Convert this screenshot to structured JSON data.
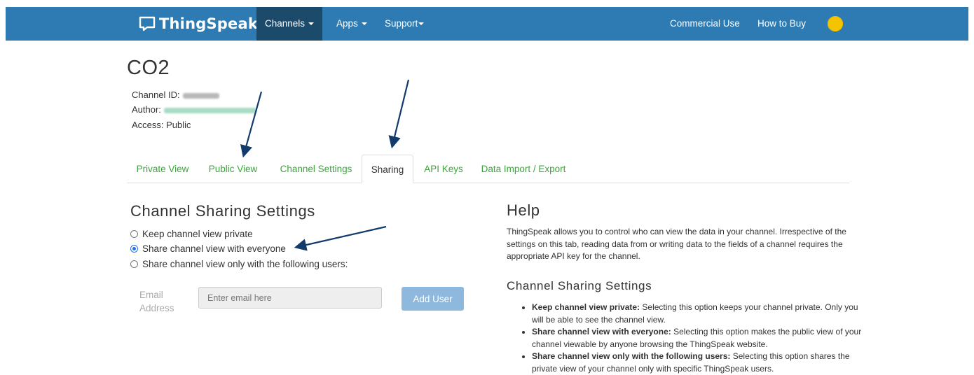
{
  "navbar": {
    "brand": "ThingSpeak",
    "brand_tm": "™",
    "items": [
      {
        "label": "Channels"
      },
      {
        "label": "Apps"
      },
      {
        "label": "Support"
      }
    ],
    "right_items": [
      {
        "label": "Commercial Use"
      },
      {
        "label": "How to Buy"
      }
    ],
    "colors": {
      "bar": "#2d7bb2",
      "active": "#1c4a6b",
      "avatar": "#f5c400"
    }
  },
  "channel": {
    "title": "CO2",
    "id_label": "Channel ID:",
    "author_label": "Author:",
    "access": "Access: Public"
  },
  "tabs": [
    {
      "label": "Private View"
    },
    {
      "label": "Public View"
    },
    {
      "label": "Channel Settings"
    },
    {
      "label": "Sharing",
      "active": true
    },
    {
      "label": "API Keys"
    },
    {
      "label": "Data Import / Export"
    }
  ],
  "sharing": {
    "heading": "Channel Sharing Settings",
    "options": [
      {
        "label": "Keep channel view private",
        "selected": false
      },
      {
        "label": "Share channel view with everyone",
        "selected": true
      },
      {
        "label": "Share channel view only with the following users:",
        "selected": false
      }
    ],
    "email_label_1": "Email",
    "email_label_2": "Address",
    "email_placeholder": "Enter email here",
    "add_button": "Add User"
  },
  "help": {
    "heading": "Help",
    "text": "ThingSpeak allows you to control who can view the data in your channel. Irrespective of the settings on this tab, reading data from or writing data to the fields of a channel requires the appropriate API key for the channel.",
    "subheading": "Channel Sharing Settings",
    "items": [
      {
        "title": "Keep channel view private:",
        "text": " Selecting this option keeps your channel private. Only you will be able to see the channel view."
      },
      {
        "title": "Share channel view with everyone:",
        "text": " Selecting this option makes the public view of your channel viewable by anyone browsing the ThingSpeak website."
      },
      {
        "title": "Share channel view only with the following users:",
        "text": " Selecting this option shares the private view of your channel only with specific ThingSpeak users."
      }
    ]
  },
  "colors": {
    "link_green": "#3aa63a",
    "arrow": "#123a6b"
  }
}
